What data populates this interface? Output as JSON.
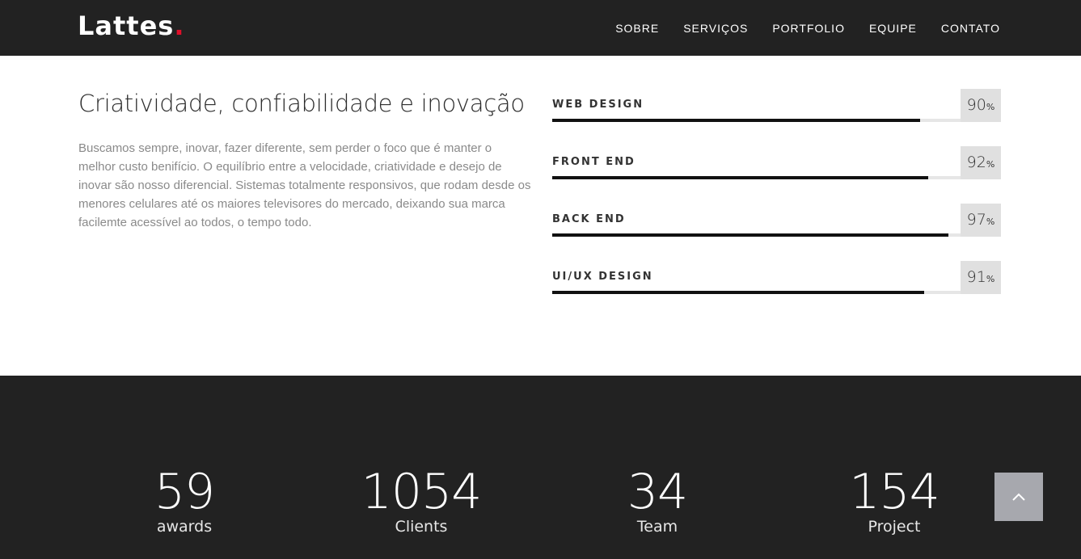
{
  "brand": {
    "name": "Lattes",
    "dot": ".",
    "dot_color": "#e0102a"
  },
  "nav": {
    "items": [
      {
        "label": "SOBRE"
      },
      {
        "label": "SERVIÇOS"
      },
      {
        "label": "PORTFOLIO"
      },
      {
        "label": "EQUIPE"
      },
      {
        "label": "CONTATO"
      }
    ]
  },
  "about": {
    "heading": "Criatividade, confiabilidade e inovação",
    "text": "Buscamos sempre, inovar, fazer diferente, sem perder o foco que é manter o melhor custo benifício. O equilíbrio entre a velocidade, criatividade e desejo de inovar são nosso diferencial. Sistemas totalmente responsivos, que rodam desde os menores celulares até os maiores televisores do mercado, deixando sua marca facilemte acessível ao todos, o tempo todo."
  },
  "skills": [
    {
      "label": "WEB DESIGN",
      "value": "90",
      "unit": "%",
      "level": 0.9
    },
    {
      "label": "FRONT END",
      "value": "92",
      "unit": "%",
      "level": 0.92
    },
    {
      "label": "BACK END",
      "value": "97",
      "unit": "%",
      "level": 0.97
    },
    {
      "label": "UI/UX DESIGN",
      "value": "91",
      "unit": "%",
      "level": 0.91
    }
  ],
  "stats": [
    {
      "number": "59",
      "label": "awards"
    },
    {
      "number": "1054",
      "label": "Clients"
    },
    {
      "number": "34",
      "label": "Team"
    },
    {
      "number": "154",
      "label": "Project"
    }
  ],
  "colors": {
    "nav_bg": "#222222",
    "accent": "#e0102a",
    "bar_fill": "#111111",
    "bar_track": "#e6e6e6",
    "back_top_bg": "#a7a8ae"
  },
  "back_to_top": {
    "icon": "chevron-up-icon"
  }
}
